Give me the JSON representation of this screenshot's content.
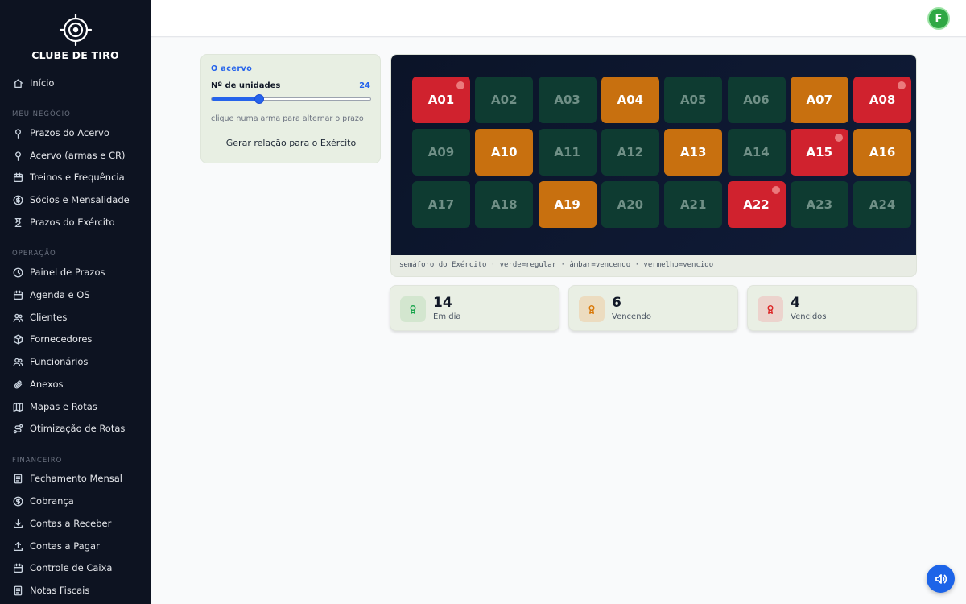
{
  "brand": {
    "name": "CLUBE DE TIRO"
  },
  "sidebar": {
    "home": {
      "label": "Início",
      "icon": "home-icon"
    },
    "sections": [
      {
        "title": "MEU NEGÓCIO",
        "items": [
          {
            "label": "Prazos do Acervo",
            "icon": "pin-icon"
          },
          {
            "label": "Acervo (armas e CR)",
            "icon": "pin-icon"
          },
          {
            "label": "Treinos e Frequência",
            "icon": "calendar-icon"
          },
          {
            "label": "Sócios e Mensalidade",
            "icon": "dollar-icon"
          },
          {
            "label": "Prazos do Exército",
            "icon": "hourglass-icon"
          }
        ]
      },
      {
        "title": "OPERAÇÃO",
        "items": [
          {
            "label": "Painel de Prazos",
            "icon": "clock-icon"
          },
          {
            "label": "Agenda e OS",
            "icon": "calendar-icon"
          },
          {
            "label": "Clientes",
            "icon": "users-icon"
          },
          {
            "label": "Fornecedores",
            "icon": "box-icon"
          },
          {
            "label": "Funcionários",
            "icon": "users-icon"
          },
          {
            "label": "Anexos",
            "icon": "paperclip-icon"
          },
          {
            "label": "Mapas e Rotas",
            "icon": "map-icon"
          },
          {
            "label": "Otimização de Rotas",
            "icon": "route-icon"
          }
        ]
      },
      {
        "title": "FINANCEIRO",
        "items": [
          {
            "label": "Fechamento Mensal",
            "icon": "document-icon"
          },
          {
            "label": "Cobrança",
            "icon": "dollar-icon"
          },
          {
            "label": "Contas a Receber",
            "icon": "download-icon"
          },
          {
            "label": "Contas a Pagar",
            "icon": "upload-icon"
          },
          {
            "label": "Controle de Caixa",
            "icon": "calendar-icon"
          },
          {
            "label": "Notas Fiscais",
            "icon": "document-icon"
          }
        ]
      }
    ]
  },
  "header": {
    "avatar_initial": "F"
  },
  "control": {
    "title": "O acervo",
    "units_label": "Nº de unidades",
    "units_value": "24",
    "slider_fraction": 0.3,
    "hint": "clique numa arma para alternar o prazo",
    "button_label": "Gerar relação para o Exército"
  },
  "grid": {
    "cells": [
      {
        "id": "A01",
        "status": "red",
        "flag": true
      },
      {
        "id": "A02",
        "status": "green",
        "flag": false
      },
      {
        "id": "A03",
        "status": "green",
        "flag": false
      },
      {
        "id": "A04",
        "status": "amber",
        "flag": false
      },
      {
        "id": "A05",
        "status": "green",
        "flag": false
      },
      {
        "id": "A06",
        "status": "green",
        "flag": false
      },
      {
        "id": "A07",
        "status": "amber",
        "flag": false
      },
      {
        "id": "A08",
        "status": "red",
        "flag": true
      },
      {
        "id": "A09",
        "status": "green",
        "flag": false
      },
      {
        "id": "A10",
        "status": "amber",
        "flag": false
      },
      {
        "id": "A11",
        "status": "green",
        "flag": false
      },
      {
        "id": "A12",
        "status": "green",
        "flag": false
      },
      {
        "id": "A13",
        "status": "amber",
        "flag": false
      },
      {
        "id": "A14",
        "status": "green",
        "flag": false
      },
      {
        "id": "A15",
        "status": "red",
        "flag": true
      },
      {
        "id": "A16",
        "status": "amber",
        "flag": false
      },
      {
        "id": "A17",
        "status": "green",
        "flag": false
      },
      {
        "id": "A18",
        "status": "green",
        "flag": false
      },
      {
        "id": "A19",
        "status": "amber",
        "flag": false
      },
      {
        "id": "A20",
        "status": "green",
        "flag": false
      },
      {
        "id": "A21",
        "status": "green",
        "flag": false
      },
      {
        "id": "A22",
        "status": "red",
        "flag": true
      },
      {
        "id": "A23",
        "status": "green",
        "flag": false
      },
      {
        "id": "A24",
        "status": "green",
        "flag": false
      }
    ],
    "legend": "semáforo do Exército · verde=regular · âmbar=vencendo · vermelho=vencido"
  },
  "stats": [
    {
      "value": "14",
      "label": "Em dia",
      "color": "#16a34a",
      "bg": "#d3e6cf",
      "icon": "award-icon"
    },
    {
      "value": "6",
      "label": "Vencendo",
      "color": "#d97706",
      "bg": "#ecdcc0",
      "icon": "award-icon"
    },
    {
      "value": "4",
      "label": "Vencidos",
      "color": "#dc2626",
      "bg": "#ecd3cd",
      "icon": "award-icon"
    }
  ],
  "colors": {
    "accent": "#2563eb",
    "sidebar_bg": "#0d1321",
    "green_cell": "#0e3b31",
    "amber_cell": "#c8700f",
    "red_cell": "#d0222e"
  },
  "fab": {
    "icon": "speaker-icon"
  }
}
